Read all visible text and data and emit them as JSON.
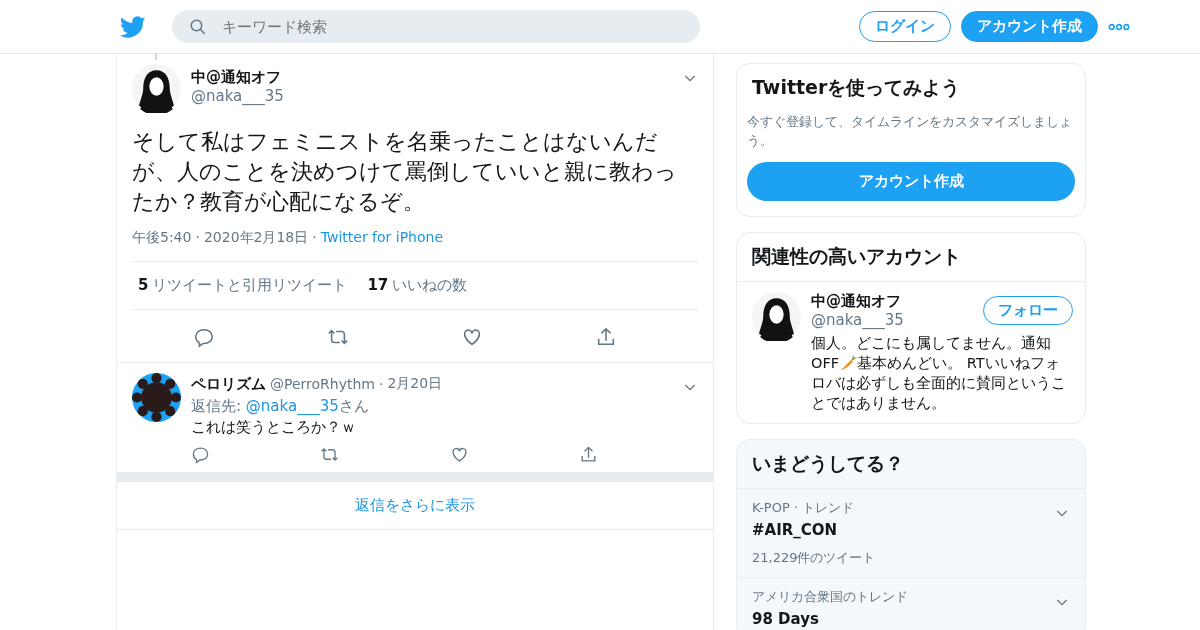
{
  "header": {
    "search": {
      "placeholder": "キーワード検索"
    },
    "buttons": [
      {
        "label": "ログイン",
        "kind": "outline"
      },
      {
        "label": "アカウント作成",
        "kind": "filled"
      }
    ]
  },
  "tweet": {
    "name": "中@通知オフ",
    "handle": "@naka___35",
    "text": "そして私はフェミニストを名乗ったことはないんだが、人のことを決めつけて罵倒していいと親に教わったか？教育が心配になるぞ。",
    "time": "午後5:40",
    "separator": "·",
    "date": "2020年2月18日",
    "source": "Twitter for iPhone",
    "stats": [
      {
        "count": "5",
        "label": "リツイートと引用リツイート"
      },
      {
        "count": "17",
        "label": "いいねの数"
      }
    ]
  },
  "replies": [
    {
      "name": "ペロリズム",
      "handle": "@PerroRhythm",
      "separator": "·",
      "date": "2月20日",
      "reply_to_label": "返信先: ",
      "reply_to": "@naka___35",
      "reply_to_suffix": "さん",
      "text": "これは笑うところか？ｗ"
    }
  ],
  "more_replies": "返信をさらに表示",
  "signup_card": {
    "title": "Twitterを使ってみよう",
    "text": "今すぐ登録して、タイムラインをカスタマイズしましょう。",
    "button": "アカウント作成"
  },
  "related": {
    "title": "関連性の高いアカウント",
    "accounts": [
      {
        "name": "中@通知オフ",
        "handle": "@naka___35",
        "follow": "フォロー",
        "bio_line1": "個人。どこにも属してません。通知",
        "bio_line2_start": "OFF",
        "bio_line2_end": "基本めんどい。 RTいいねフォ",
        "bio_rest": "ロバは必ずしも全面的に賛同ということではありません。"
      }
    ]
  },
  "trends": {
    "title": "いまどうしてる？",
    "items": [
      {
        "context": "K-POP · トレンド",
        "name": "#AIR_CON",
        "count": "21,229件のツイート"
      },
      {
        "context": "アメリカ合衆国のトレンド",
        "name": "98 Days"
      }
    ]
  }
}
